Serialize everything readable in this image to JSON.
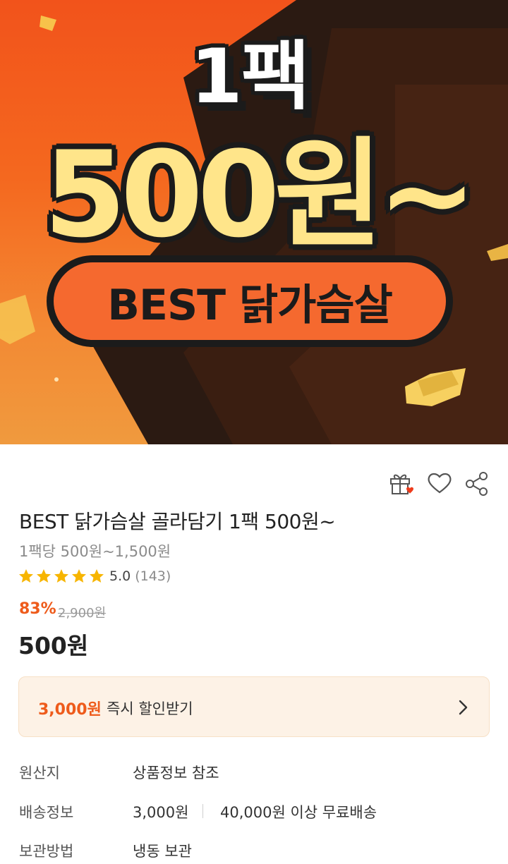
{
  "banner": {
    "pack_text": "1팩",
    "price_text": "500원~",
    "pill_text": "BEST 닭가슴살"
  },
  "actions": {
    "gift_icon": "gift-icon",
    "wishlist_icon": "heart-icon",
    "share_icon": "share-icon"
  },
  "product": {
    "title": "BEST 닭가슴살 골라담기 1팩 500원~",
    "subtitle": "1팩당 500원~1,500원",
    "rating_score": "5.0",
    "rating_count": "(143)",
    "stars": 5,
    "discount_rate": "83%",
    "original_price": "2,900원",
    "price": "500원"
  },
  "coupon": {
    "amount": "3,000원",
    "label": "즉시 할인받기"
  },
  "info": {
    "origin_label": "원산지",
    "origin_value": "상품정보 참조",
    "shipping_label": "배송정보",
    "shipping_fee": "3,000원",
    "shipping_free": "40,000원 이상 무료배송",
    "storage_label": "보관방법",
    "storage_value": "냉동 보관"
  },
  "colors": {
    "accent": "#ee5b1b",
    "banner_orange": "#f2531b",
    "banner_yellow": "#ffe58a",
    "star": "#f7b500",
    "coupon_bg": "#fdf2e6"
  }
}
